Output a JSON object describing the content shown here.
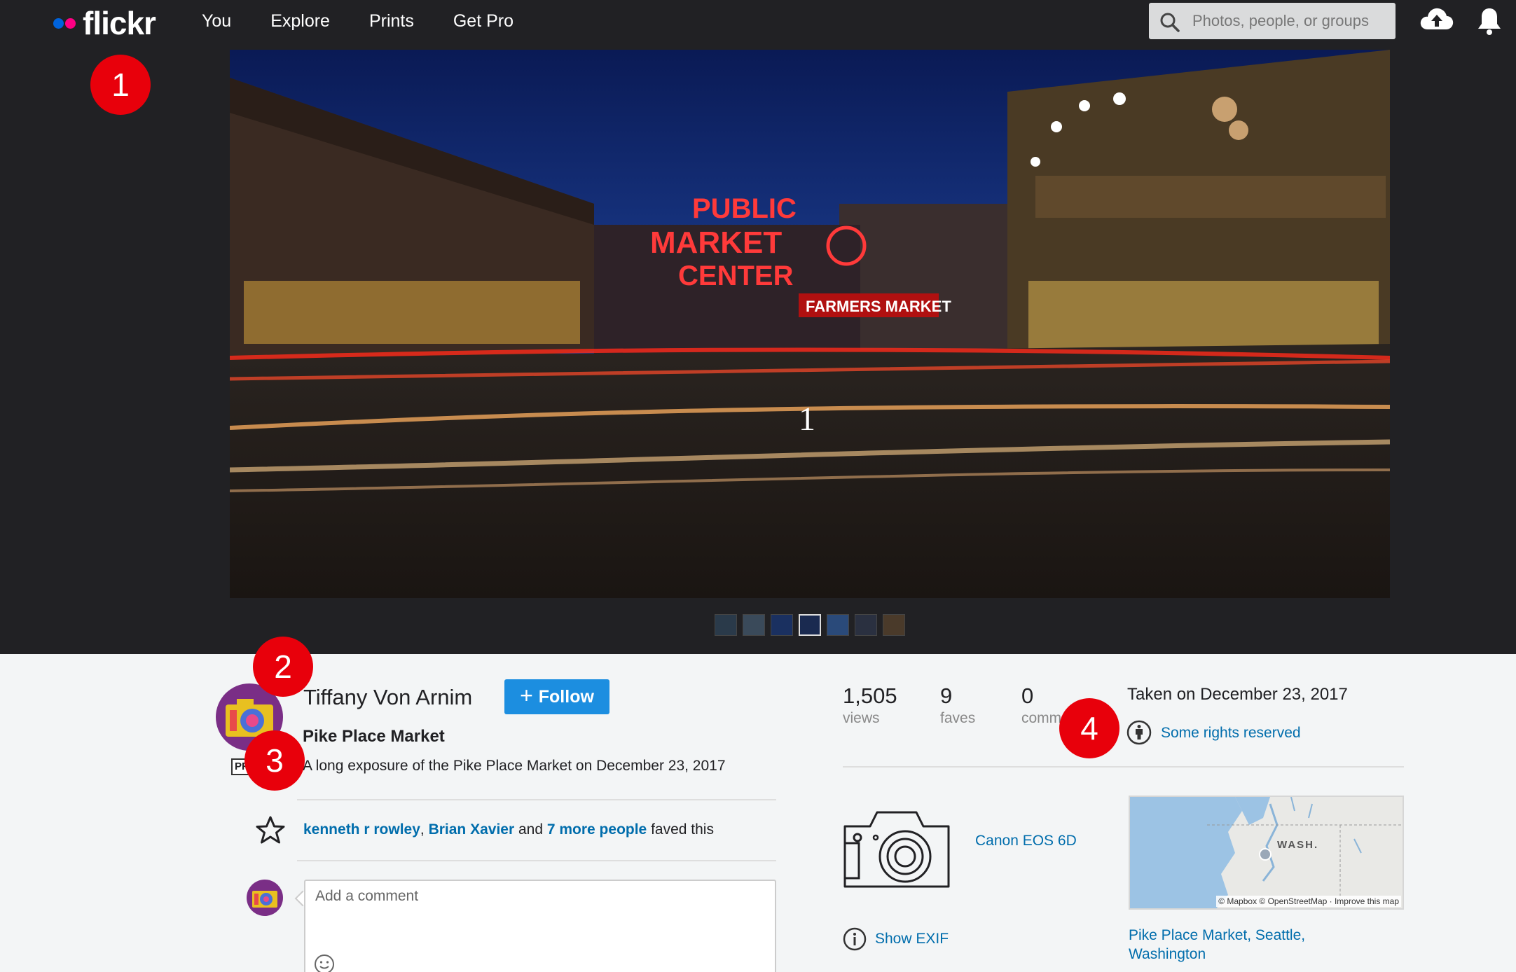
{
  "topbar": {
    "logo_text": "flickr",
    "nav": [
      "You",
      "Explore",
      "Prints",
      "Get Pro"
    ],
    "search_placeholder": "Photos, people, or groups"
  },
  "photo": {
    "index_label": "1",
    "thumbnail_count": 7,
    "active_thumbnail": 3
  },
  "markers": [
    "1",
    "2",
    "3",
    "4"
  ],
  "owner": {
    "name": "Tiffany Von Arnim",
    "follow_label": "Follow",
    "pro_badge": "PRO"
  },
  "details": {
    "title": "Pike Place Market",
    "description": "A long exposure of the Pike Place Market on December 23, 2017"
  },
  "faves": {
    "person1": "kenneth r rowley",
    "sep1": ", ",
    "person2": "Brian Xavier",
    "sep2": " and ",
    "more": "7 more people",
    "suffix": " faved this"
  },
  "comment": {
    "placeholder": "Add a comment"
  },
  "stats": {
    "views_num": "1,505",
    "views_label": "views",
    "faves_num": "9",
    "faves_label": "faves",
    "comments_num": "0",
    "comments_label": "comments"
  },
  "meta": {
    "taken": "Taken on December 23, 2017",
    "license": "Some rights reserved",
    "camera": "Canon EOS 6D",
    "show_exif": "Show EXIF",
    "map_label": "WASH.",
    "map_attribution": "© Mapbox © OpenStreetMap · Improve this map",
    "location": "Pike Place Market, Seattle, Washington"
  },
  "colors": {
    "topbar": "#212124",
    "link": "#006dac",
    "follow": "#1c8ee0",
    "marker": "#e8000b",
    "logo_blue": "#0063dc",
    "logo_pink": "#ff0084"
  }
}
